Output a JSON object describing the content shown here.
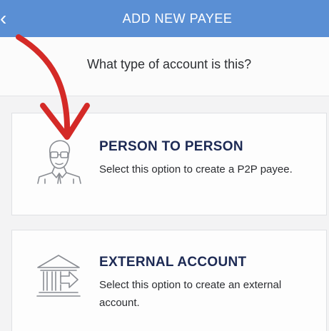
{
  "header": {
    "back_icon": "chevron-left-icon",
    "title": "ADD NEW PAYEE",
    "color": "#5a8fd4"
  },
  "question": "What type of account is this?",
  "options": [
    {
      "icon": "person-icon",
      "title": "PERSON TO PERSON",
      "description": "Select this option to create a P2P payee."
    },
    {
      "icon": "bank-transfer-icon",
      "title": "EXTERNAL ACCOUNT",
      "description": "Select this option to create an external account."
    }
  ],
  "annotation": {
    "icon": "red-arrow-icon",
    "color": "#d42a27"
  }
}
